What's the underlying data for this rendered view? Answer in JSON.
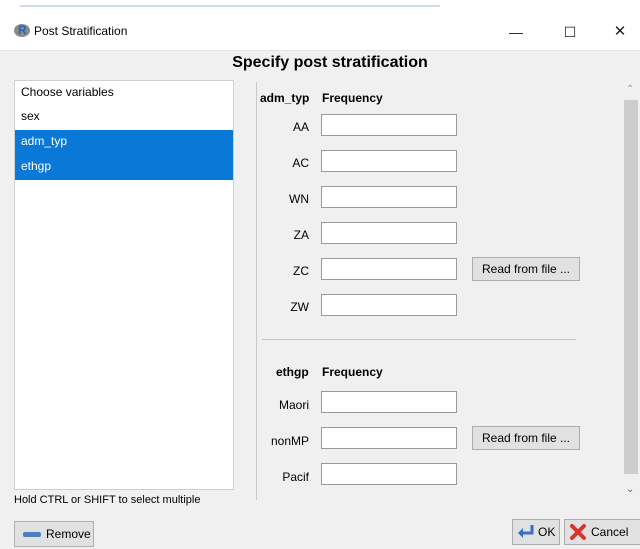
{
  "window": {
    "title": "Post Stratification",
    "app_letter": "R"
  },
  "heading": "Specify post stratification",
  "variables": {
    "header": "Choose variables",
    "items": [
      {
        "label": "sex",
        "selected": false
      },
      {
        "label": "adm_typ",
        "selected": true
      },
      {
        "label": "ethgp",
        "selected": true
      }
    ],
    "hint": "Hold CTRL or SHIFT to select multiple"
  },
  "groups": [
    {
      "variable": "adm_typ",
      "freq_header": "Frequency",
      "levels": [
        "AA",
        "AC",
        "WN",
        "ZA",
        "ZC",
        "ZW"
      ],
      "read_button": "Read from file ..."
    },
    {
      "variable": "ethgp",
      "freq_header": "Frequency",
      "levels": [
        "Maori",
        "nonMP",
        "Pacif"
      ],
      "read_button": "Read from file ..."
    }
  ],
  "buttons": {
    "remove": "Remove",
    "ok": "OK",
    "cancel": "Cancel"
  },
  "colors": {
    "selection": "#0a78d7",
    "accent": "#1f66c1"
  }
}
